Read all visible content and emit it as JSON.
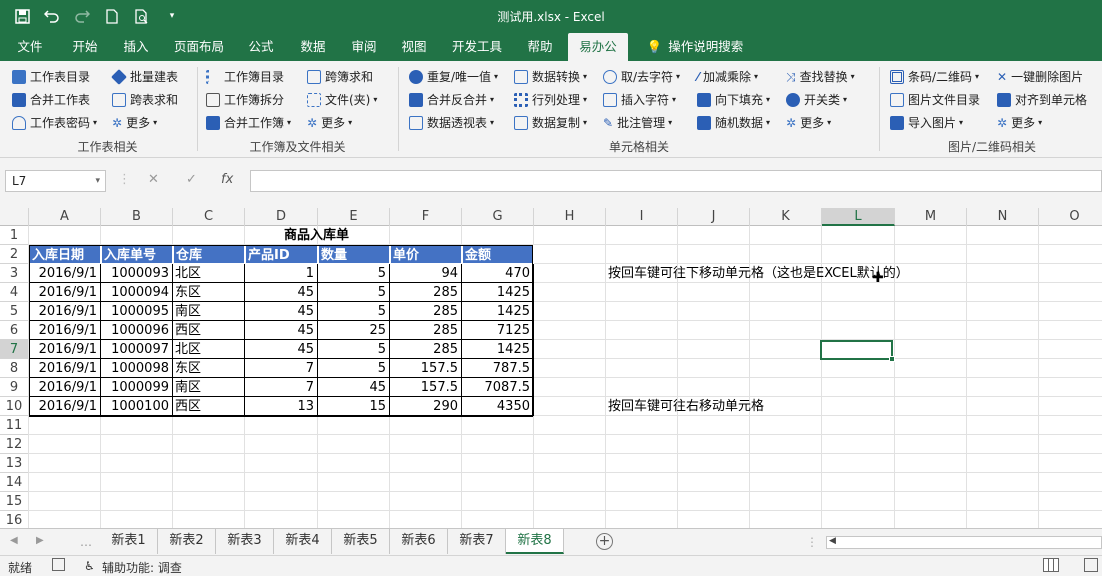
{
  "app": {
    "window_title": "测试用.xlsx  -  Excel",
    "accent_color": "#217346"
  },
  "qat": {
    "icons": [
      "save-icon",
      "undo-icon",
      "redo-icon",
      "new-file-icon",
      "print-preview-icon",
      "customize-icon"
    ]
  },
  "tabs": [
    "文件",
    "开始",
    "插入",
    "页面布局",
    "公式",
    "数据",
    "审阅",
    "视图",
    "开发工具",
    "帮助",
    "易办公",
    "操作说明搜索"
  ],
  "active_tab": "易办公",
  "ribbon": {
    "groups": [
      {
        "label": "工作表相关",
        "items": [
          "工作表目录",
          "批量建表",
          "合并工作表",
          "跨表求和",
          "工作表密码",
          "更多"
        ]
      },
      {
        "label": "工作簿及文件相关",
        "items": [
          "工作簿目录",
          "跨簿求和",
          "工作簿拆分",
          "文件(夹)",
          "合并工作簿",
          "更多"
        ]
      },
      {
        "label": "单元格相关",
        "items": [
          "重复/唯一值",
          "数据转换",
          "取/去字符",
          "加减乘除",
          "查找替换",
          "合并反合并",
          "行列处理",
          "插入字符",
          "向下填充",
          "开关类",
          "数据透视表",
          "数据复制",
          "批注管理",
          "随机数据",
          "更多"
        ]
      },
      {
        "label": "图片/二维码相关",
        "items": [
          "条码/二维码",
          "一键删除图片",
          "图片文件目录",
          "对齐到单元格",
          "导入图片",
          "更多"
        ]
      }
    ]
  },
  "formula_bar": {
    "name_box": "L7",
    "cancel": "✕",
    "enter": "✓",
    "fx": "fx",
    "formula": ""
  },
  "columns": [
    "A",
    "B",
    "C",
    "D",
    "E",
    "F",
    "G",
    "H",
    "I",
    "J",
    "K",
    "L",
    "M",
    "N",
    "O"
  ],
  "selected_column": "L",
  "rows": [
    "1",
    "2",
    "3",
    "4",
    "5",
    "6",
    "7",
    "8",
    "9",
    "10",
    "11",
    "12",
    "13",
    "14",
    "15",
    "16"
  ],
  "sheet": {
    "title": "商品入库单",
    "headers": [
      "入库日期",
      "入库单号",
      "仓库",
      "产品ID",
      "数量",
      "单价",
      "金额"
    ],
    "data": [
      [
        "2016/9/1",
        "1000093",
        "北区",
        "1",
        "5",
        "94",
        "470"
      ],
      [
        "2016/9/1",
        "1000094",
        "东区",
        "45",
        "5",
        "285",
        "1425"
      ],
      [
        "2016/9/1",
        "1000095",
        "南区",
        "45",
        "5",
        "285",
        "1425"
      ],
      [
        "2016/9/1",
        "1000096",
        "西区",
        "45",
        "25",
        "285",
        "7125"
      ],
      [
        "2016/9/1",
        "1000097",
        "北区",
        "45",
        "5",
        "285",
        "1425"
      ],
      [
        "2016/9/1",
        "1000098",
        "东区",
        "7",
        "5",
        "157.5",
        "787.5"
      ],
      [
        "2016/9/1",
        "1000099",
        "南区",
        "7",
        "45",
        "157.5",
        "7087.5"
      ],
      [
        "2016/9/1",
        "1000100",
        "西区",
        "13",
        "15",
        "290",
        "4350"
      ]
    ],
    "note1": "按回车键可往下移动单元格（这也是EXCEL默认的）",
    "note2": "按回车键可往右移动单元格"
  },
  "sheet_tabs": [
    "新表1",
    "新表2",
    "新表3",
    "新表4",
    "新表5",
    "新表6",
    "新表7",
    "新表8"
  ],
  "active_sheet": "新表8",
  "status": {
    "ready": "就绪",
    "accessibility": "辅助功能: 调查"
  }
}
